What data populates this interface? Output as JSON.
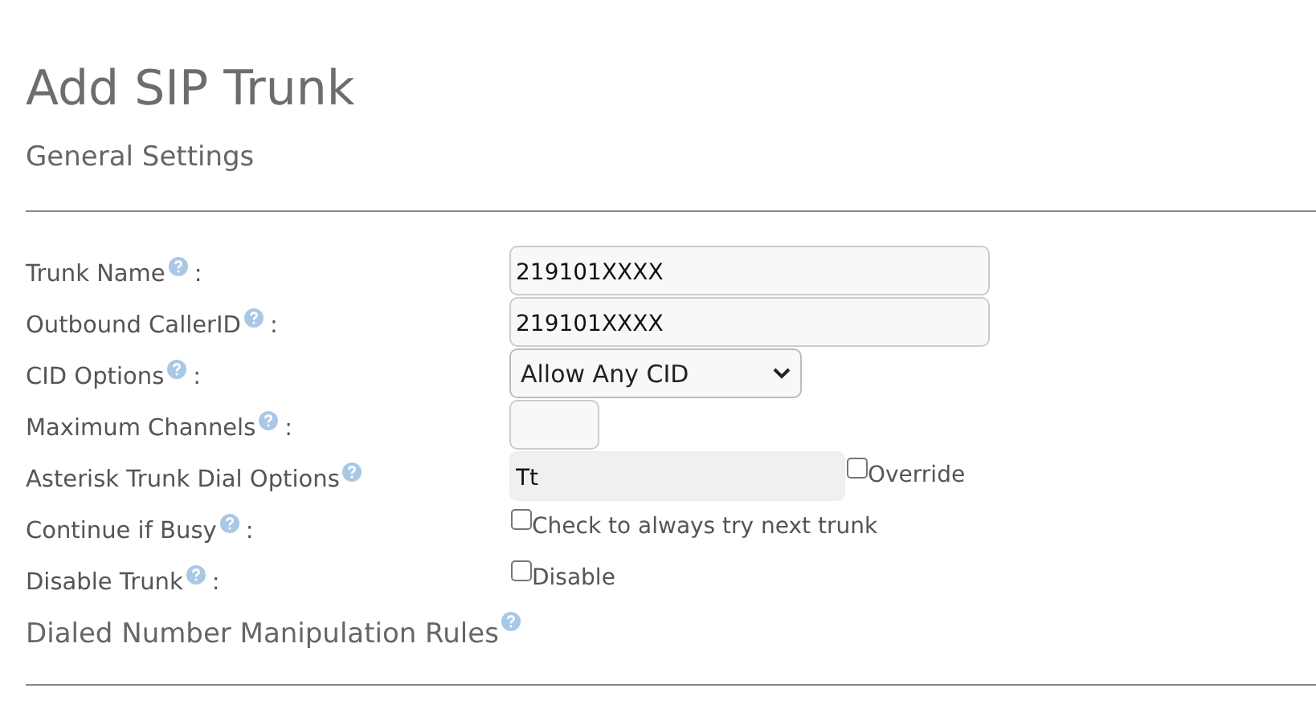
{
  "title": "Add SIP Trunk",
  "section": "General Settings",
  "fields": [
    {
      "label": "Trunk Name",
      "suffix": ":",
      "kind": "text",
      "value": "219101XXXX"
    },
    {
      "label": "Outbound CallerID",
      "suffix": ":",
      "kind": "text",
      "value": "219101XXXX"
    },
    {
      "label": "CID Options",
      "suffix": ":",
      "kind": "select",
      "value": "Allow Any CID"
    },
    {
      "label": "Maximum Channels",
      "suffix": ":",
      "kind": "number"
    },
    {
      "label": "Asterisk Trunk Dial Options",
      "kind": "text-override",
      "value": "Tt",
      "disabled": true,
      "checked": false,
      "option": "Override"
    },
    {
      "label": "Continue if Busy",
      "suffix": ":",
      "kind": "checkbox",
      "checked": false,
      "option": "Check to always try next trunk"
    },
    {
      "label": "Disable Trunk",
      "suffix": ":",
      "kind": "checkbox",
      "checked": false,
      "option": "Disable"
    }
  ],
  "next_section": "Dialed Number Manipulation Rules"
}
